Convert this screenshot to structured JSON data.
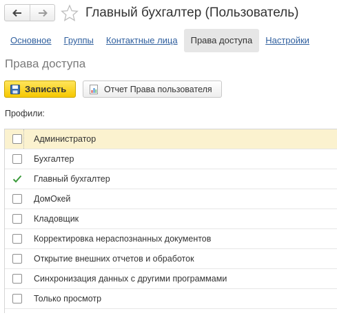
{
  "window": {
    "title": "Главный бухгалтер (Пользователь)"
  },
  "tabs": [
    {
      "label": "Основное",
      "active": false
    },
    {
      "label": "Группы",
      "active": false
    },
    {
      "label": "Контактные лица",
      "active": false
    },
    {
      "label": "Права доступа",
      "active": true
    },
    {
      "label": "Настройки",
      "active": false
    }
  ],
  "section": {
    "title": "Права доступа"
  },
  "toolbar": {
    "save_label": "Записать",
    "report_label": "Отчет Права пользователя"
  },
  "profiles": {
    "label": "Профили:",
    "items": [
      {
        "name": "Администратор",
        "checked": false,
        "selected": true
      },
      {
        "name": "Бухгалтер",
        "checked": false,
        "selected": false
      },
      {
        "name": "Главный бухгалтер",
        "checked": true,
        "selected": false
      },
      {
        "name": "ДомОкей",
        "checked": false,
        "selected": false
      },
      {
        "name": "Кладовщик",
        "checked": false,
        "selected": false
      },
      {
        "name": "Корректировка нераспознанных документов",
        "checked": false,
        "selected": false
      },
      {
        "name": "Открытие внешних отчетов и обработок",
        "checked": false,
        "selected": false
      },
      {
        "name": "Синхронизация данных с другими программами",
        "checked": false,
        "selected": false
      },
      {
        "name": "Только просмотр",
        "checked": false,
        "selected": false
      }
    ]
  },
  "colors": {
    "link": "#2f5f9e",
    "save_button": "#f6c800",
    "selected_row": "#fbf2cf",
    "check_mark": "#3a9a3a"
  },
  "icons": {
    "back": "arrow-left-icon",
    "forward": "arrow-right-icon",
    "favorite": "star-outline-icon",
    "save": "floppy-disk-icon",
    "report": "report-chart-icon",
    "check": "check-mark-icon"
  }
}
